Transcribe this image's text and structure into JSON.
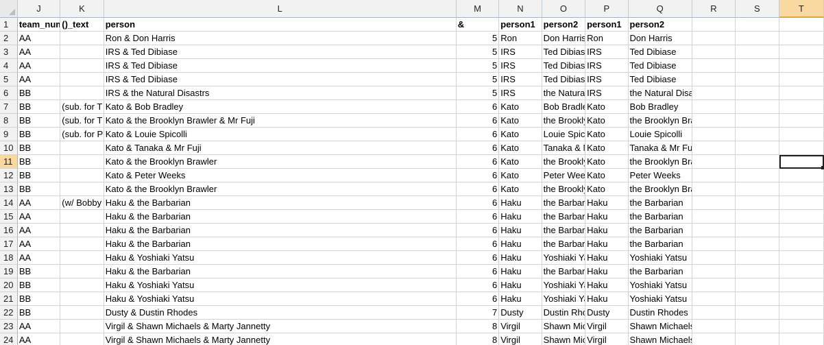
{
  "columns": [
    "J",
    "K",
    "L",
    "M",
    "N",
    "O",
    "P",
    "Q",
    "R",
    "S",
    "T"
  ],
  "selected_column": "T",
  "selected_row": "11",
  "rows": [
    {
      "num": "1",
      "J": "team_num",
      "K": "()_text",
      "L": "person",
      "M": "&",
      "N": "person1",
      "O": "person2",
      "P": "person1",
      "Q": "person2",
      "R": "",
      "S": "",
      "T": ""
    },
    {
      "num": "2",
      "J": "AA",
      "K": "",
      "L": "Ron & Don Harris",
      "M": "5",
      "N": "Ron",
      "O": "Don Harris",
      "P": "Ron",
      "Q": "Don Harris",
      "R": "",
      "S": "",
      "T": ""
    },
    {
      "num": "3",
      "J": "AA",
      "K": "",
      "L": "IRS & Ted Dibiase",
      "M": "5",
      "N": "IRS",
      "O": "Ted Dibiase",
      "P": "IRS",
      "Q": "Ted Dibiase",
      "R": "",
      "S": "",
      "T": ""
    },
    {
      "num": "4",
      "J": "AA",
      "K": "",
      "L": "IRS & Ted Dibiase",
      "M": "5",
      "N": "IRS",
      "O": "Ted Dibiase",
      "P": "IRS",
      "Q": "Ted Dibiase",
      "R": "",
      "S": "",
      "T": ""
    },
    {
      "num": "5",
      "J": "AA",
      "K": "",
      "L": "IRS & Ted Dibiase",
      "M": "5",
      "N": "IRS",
      "O": "Ted Dibiase",
      "P": "IRS",
      "Q": "Ted Dibiase",
      "R": "",
      "S": "",
      "T": ""
    },
    {
      "num": "6",
      "J": "BB",
      "K": "",
      "L": "IRS & the Natural Disastrs",
      "M": "5",
      "N": "IRS",
      "O": "the Natural",
      "P": "IRS",
      "Q": "the Natural Disastrs",
      "R": "",
      "S": "",
      "T": ""
    },
    {
      "num": "7",
      "J": "BB",
      "K": "(sub. for T",
      "L": "Kato & Bob Bradley",
      "M": "6",
      "N": "Kato",
      "O": "Bob Bradley",
      "P": "Kato",
      "Q": "Bob Bradley",
      "R": "",
      "S": "",
      "T": ""
    },
    {
      "num": "8",
      "J": "BB",
      "K": "(sub. for T",
      "L": "Kato & the Brooklyn Brawler & Mr Fuji",
      "M": "6",
      "N": "Kato",
      "O": "the Brooklyn",
      "P": "Kato",
      "Q": "the Brooklyn Brawler & Mr Fuji",
      "R": "",
      "S": "",
      "T": ""
    },
    {
      "num": "9",
      "J": "BB",
      "K": "(sub. for P",
      "L": "Kato & Louie Spicolli",
      "M": "6",
      "N": "Kato",
      "O": "Louie Spicolli",
      "P": "Kato",
      "Q": "Louie Spicolli",
      "R": "",
      "S": "",
      "T": ""
    },
    {
      "num": "10",
      "J": "BB",
      "K": "",
      "L": "Kato & Tanaka & Mr Fuji",
      "M": "6",
      "N": "Kato",
      "O": "Tanaka & Mr",
      "P": "Kato",
      "Q": "Tanaka & Mr Fuji",
      "R": "",
      "S": "",
      "T": ""
    },
    {
      "num": "11",
      "J": "BB",
      "K": "",
      "L": "Kato & the Brooklyn Brawler",
      "M": "6",
      "N": "Kato",
      "O": "the Brooklyn",
      "P": "Kato",
      "Q": "the Brooklyn Brawler",
      "R": "",
      "S": "",
      "T": ""
    },
    {
      "num": "12",
      "J": "BB",
      "K": "",
      "L": "Kato & Peter Weeks",
      "M": "6",
      "N": "Kato",
      "O": "Peter Weeks",
      "P": "Kato",
      "Q": "Peter Weeks",
      "R": "",
      "S": "",
      "T": ""
    },
    {
      "num": "13",
      "J": "BB",
      "K": "",
      "L": "Kato & the Brooklyn Brawler",
      "M": "6",
      "N": "Kato",
      "O": "the Brooklyn",
      "P": "Kato",
      "Q": "the Brooklyn Brawler",
      "R": "",
      "S": "",
      "T": ""
    },
    {
      "num": "14",
      "J": "AA",
      "K": "(w/ Bobby",
      "L": "Haku & the Barbarian",
      "M": "6",
      "N": "Haku",
      "O": "the Barbarian",
      "P": "Haku",
      "Q": "the Barbarian",
      "R": "",
      "S": "",
      "T": ""
    },
    {
      "num": "15",
      "J": "AA",
      "K": "",
      "L": "Haku & the Barbarian",
      "M": "6",
      "N": "Haku",
      "O": "the Barbarian",
      "P": "Haku",
      "Q": "the Barbarian",
      "R": "",
      "S": "",
      "T": ""
    },
    {
      "num": "16",
      "J": "AA",
      "K": "",
      "L": "Haku & the Barbarian",
      "M": "6",
      "N": "Haku",
      "O": "the Barbarian",
      "P": "Haku",
      "Q": "the Barbarian",
      "R": "",
      "S": "",
      "T": ""
    },
    {
      "num": "17",
      "J": "AA",
      "K": "",
      "L": "Haku & the Barbarian",
      "M": "6",
      "N": "Haku",
      "O": "the Barbarian",
      "P": "Haku",
      "Q": "the Barbarian",
      "R": "",
      "S": "",
      "T": ""
    },
    {
      "num": "18",
      "J": "AA",
      "K": "",
      "L": "Haku & Yoshiaki Yatsu",
      "M": "6",
      "N": "Haku",
      "O": "Yoshiaki Yatsu",
      "P": "Haku",
      "Q": "Yoshiaki Yatsu",
      "R": "",
      "S": "",
      "T": ""
    },
    {
      "num": "19",
      "J": "BB",
      "K": "",
      "L": "Haku & the Barbarian",
      "M": "6",
      "N": "Haku",
      "O": "the Barbarian",
      "P": "Haku",
      "Q": "the Barbarian",
      "R": "",
      "S": "",
      "T": ""
    },
    {
      "num": "20",
      "J": "BB",
      "K": "",
      "L": "Haku & Yoshiaki Yatsu",
      "M": "6",
      "N": "Haku",
      "O": "Yoshiaki Yatsu",
      "P": "Haku",
      "Q": "Yoshiaki Yatsu",
      "R": "",
      "S": "",
      "T": ""
    },
    {
      "num": "21",
      "J": "BB",
      "K": "",
      "L": "Haku & Yoshiaki Yatsu",
      "M": "6",
      "N": "Haku",
      "O": "Yoshiaki Yatsu",
      "P": "Haku",
      "Q": "Yoshiaki Yatsu",
      "R": "",
      "S": "",
      "T": ""
    },
    {
      "num": "22",
      "J": "BB",
      "K": "",
      "L": "Dusty & Dustin Rhodes",
      "M": "7",
      "N": "Dusty",
      "O": "Dustin Rhodes",
      "P": "Dusty",
      "Q": "Dustin Rhodes",
      "R": "",
      "S": "",
      "T": ""
    },
    {
      "num": "23",
      "J": "AA",
      "K": "",
      "L": "Virgil & Shawn Michaels & Marty Jannetty",
      "M": "8",
      "N": "Virgil",
      "O": "Shawn Michaels",
      "P": "Virgil",
      "Q": "Shawn Michaels & Marty Jannetty",
      "R": "",
      "S": "",
      "T": ""
    },
    {
      "num": "24",
      "J": "AA",
      "K": "",
      "L": "Virgil & Shawn Michaels & Marty Jannetty",
      "M": "8",
      "N": "Virgil",
      "O": "Shawn Michaels",
      "P": "Virgil",
      "Q": "Shawn Michaels & Marty Jannetty",
      "R": "",
      "S": "",
      "T": ""
    }
  ]
}
